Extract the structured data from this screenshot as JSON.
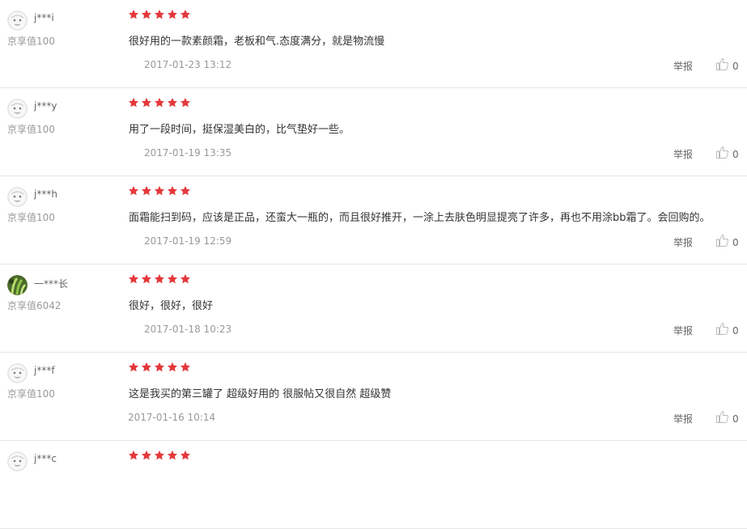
{
  "colors": {
    "star": "#e4393c",
    "divider": "#e5e5e5",
    "meta_text": "#999999"
  },
  "labels": {
    "report": "举报"
  },
  "reviews": [
    {
      "username": "j***i",
      "level": "京享值100",
      "rating": 5,
      "comment": "很好用的一款素颜霜，老板和气.态度满分，就是物流慢",
      "date": "2017-01-23 13:12",
      "likes": "0",
      "avatar_icon": "default-avatar-icon"
    },
    {
      "username": "j***y",
      "level": "京享值100",
      "rating": 5,
      "comment": "用了一段时间，挺保湿美白的，比气垫好一些。",
      "date": "2017-01-19 13:35",
      "likes": "0",
      "avatar_icon": "default-avatar-icon"
    },
    {
      "username": "j***h",
      "level": "京享值100",
      "rating": 5,
      "comment": "面霜能扫到码，应该是正品，还蛮大一瓶的，而且很好推开，一涂上去肤色明显提亮了许多，再也不用涂bb霜了。会回购的。",
      "date": "2017-01-19 12:59",
      "likes": "0",
      "avatar_icon": "default-avatar-icon"
    },
    {
      "username": "一***长",
      "level": "京享值6042",
      "rating": 5,
      "comment": "很好，很好，很好",
      "date": "2017-01-18 10:23",
      "likes": "0",
      "avatar_icon": "plant-photo-avatar-icon"
    },
    {
      "username": "j***f",
      "level": "京享值100",
      "rating": 5,
      "comment": "这是我买的第三罐了 超级好用的 很服帖又很自然 超级赞",
      "date": "2017-01-16 10:14",
      "likes": "0",
      "avatar_icon": "default-avatar-icon"
    },
    {
      "username": "j***c",
      "rating": 5,
      "avatar_icon": "default-avatar-icon"
    }
  ]
}
